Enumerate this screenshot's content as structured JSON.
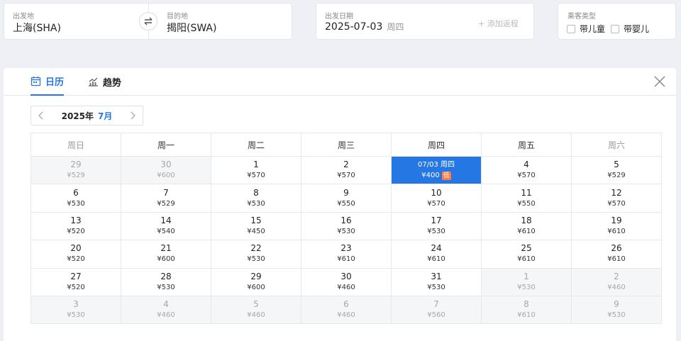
{
  "route": {
    "from_label": "出发地",
    "from_value": "上海(SHA)",
    "to_label": "目的地",
    "to_value": "揭阳(SWA)"
  },
  "date": {
    "label": "出发日期",
    "value": "2025-07-03",
    "weekday": "周四",
    "add_return": "+ 添加返程"
  },
  "passenger": {
    "label": "乘客类型",
    "options": [
      "带儿童",
      "带婴儿"
    ]
  },
  "tabs": {
    "calendar": "日历",
    "trend": "趋势"
  },
  "month_nav": {
    "year": "2025年",
    "month": "7月"
  },
  "weekdays": [
    "周日",
    "周一",
    "周二",
    "周三",
    "周四",
    "周五",
    "周六"
  ],
  "low_tag": "低",
  "calendar": [
    [
      {
        "day": "29",
        "price": "¥529",
        "other": true
      },
      {
        "day": "30",
        "price": "¥600",
        "other": true
      },
      {
        "day": "1",
        "price": "¥570"
      },
      {
        "day": "2",
        "price": "¥570"
      },
      {
        "day": "07/03 周四",
        "price": "¥400",
        "selected": true,
        "low": true
      },
      {
        "day": "4",
        "price": "¥570"
      },
      {
        "day": "5",
        "price": "¥529"
      }
    ],
    [
      {
        "day": "6",
        "price": "¥530"
      },
      {
        "day": "7",
        "price": "¥529"
      },
      {
        "day": "8",
        "price": "¥530"
      },
      {
        "day": "9",
        "price": "¥550"
      },
      {
        "day": "10",
        "price": "¥570"
      },
      {
        "day": "11",
        "price": "¥550"
      },
      {
        "day": "12",
        "price": "¥570"
      }
    ],
    [
      {
        "day": "13",
        "price": "¥520"
      },
      {
        "day": "14",
        "price": "¥540"
      },
      {
        "day": "15",
        "price": "¥450"
      },
      {
        "day": "16",
        "price": "¥530"
      },
      {
        "day": "17",
        "price": "¥530"
      },
      {
        "day": "18",
        "price": "¥610"
      },
      {
        "day": "19",
        "price": "¥610"
      }
    ],
    [
      {
        "day": "20",
        "price": "¥520"
      },
      {
        "day": "21",
        "price": "¥600"
      },
      {
        "day": "22",
        "price": "¥530"
      },
      {
        "day": "23",
        "price": "¥610"
      },
      {
        "day": "24",
        "price": "¥610"
      },
      {
        "day": "25",
        "price": "¥610"
      },
      {
        "day": "26",
        "price": "¥610"
      }
    ],
    [
      {
        "day": "27",
        "price": "¥520"
      },
      {
        "day": "28",
        "price": "¥530"
      },
      {
        "day": "29",
        "price": "¥600"
      },
      {
        "day": "30",
        "price": "¥460"
      },
      {
        "day": "31",
        "price": "¥530"
      },
      {
        "day": "1",
        "price": "¥530",
        "other": true
      },
      {
        "day": "2",
        "price": "¥460",
        "other": true
      }
    ],
    [
      {
        "day": "3",
        "price": "¥530",
        "other": true
      },
      {
        "day": "4",
        "price": "¥460",
        "other": true
      },
      {
        "day": "5",
        "price": "¥460",
        "other": true
      },
      {
        "day": "6",
        "price": "¥460",
        "other": true
      },
      {
        "day": "7",
        "price": "¥560",
        "other": true
      },
      {
        "day": "8",
        "price": "¥610",
        "other": true
      },
      {
        "day": "9",
        "price": "¥530",
        "other": true
      }
    ]
  ],
  "icons": {
    "swap": "swap-arrows-icon",
    "calendar": "calendar-icon",
    "trend": "trend-chart-icon",
    "close": "close-icon",
    "prev": "chevron-left-icon",
    "next": "chevron-right-icon"
  },
  "colors": {
    "accent": "#2577e3",
    "low_tag": "#ff7a45"
  }
}
